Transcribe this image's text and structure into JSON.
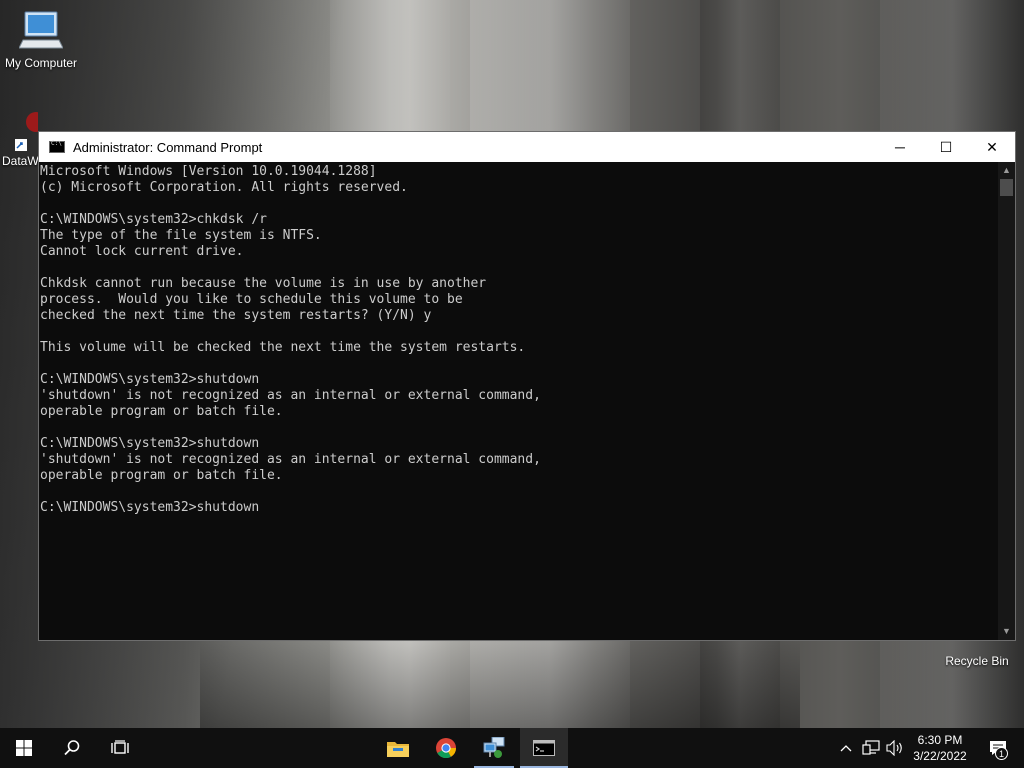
{
  "desktop": {
    "icons": [
      {
        "label": "My Computer"
      },
      {
        "label": "DataW"
      },
      {
        "label": "Recycle Bin"
      }
    ]
  },
  "window": {
    "title": "Administrator: Command Prompt",
    "controls": {
      "minimize": "─",
      "maximize": "☐",
      "close": "✕"
    },
    "console_lines": [
      "Microsoft Windows [Version 10.0.19044.1288]",
      "(c) Microsoft Corporation. All rights reserved.",
      "",
      "C:\\WINDOWS\\system32>chkdsk /r",
      "The type of the file system is NTFS.",
      "Cannot lock current drive.",
      "",
      "Chkdsk cannot run because the volume is in use by another",
      "process.  Would you like to schedule this volume to be",
      "checked the next time the system restarts? (Y/N) y",
      "",
      "This volume will be checked the next time the system restarts.",
      "",
      "C:\\WINDOWS\\system32>shutdown",
      "'shutdown' is not recognized as an internal or external command,",
      "operable program or batch file.",
      "",
      "C:\\WINDOWS\\system32>shutdown",
      "'shutdown' is not recognized as an internal or external command,",
      "operable program or batch file.",
      "",
      "C:\\WINDOWS\\system32>shutdown"
    ]
  },
  "taskbar": {
    "clock_time": "6:30 PM",
    "clock_date": "3/22/2022",
    "notification_count": "1"
  }
}
